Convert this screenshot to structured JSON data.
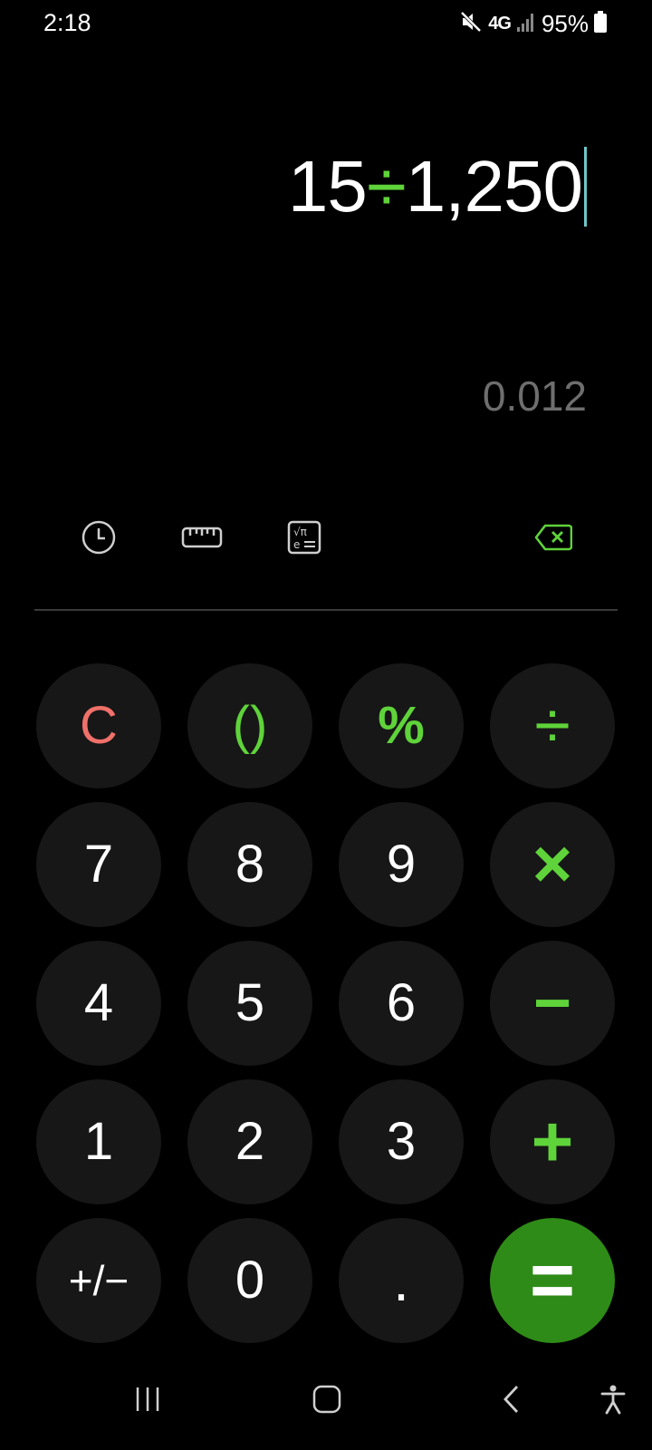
{
  "status": {
    "time": "2:18",
    "network": "4G",
    "battery": "95%"
  },
  "display": {
    "expression_left": "15",
    "expression_op": "÷",
    "expression_right": "1,250",
    "result": "0.012"
  },
  "tools": [
    "history-icon",
    "unit-converter-icon",
    "scientific-icon",
    "backspace-icon"
  ],
  "keys": {
    "clear": "C",
    "parens": "()",
    "percent": "%",
    "divide": "÷",
    "seven": "7",
    "eight": "8",
    "nine": "9",
    "multiply": "×",
    "four": "4",
    "five": "5",
    "six": "6",
    "minus": "−",
    "one": "1",
    "two": "2",
    "three": "3",
    "plus": "+",
    "plusminus": "+/−",
    "zero": "0",
    "decimal": ".",
    "equals": "="
  },
  "colors": {
    "accent_green": "#5fd33a",
    "equals_bg": "#2e8b17",
    "clear_red": "#f0706a",
    "key_bg": "#171717"
  }
}
